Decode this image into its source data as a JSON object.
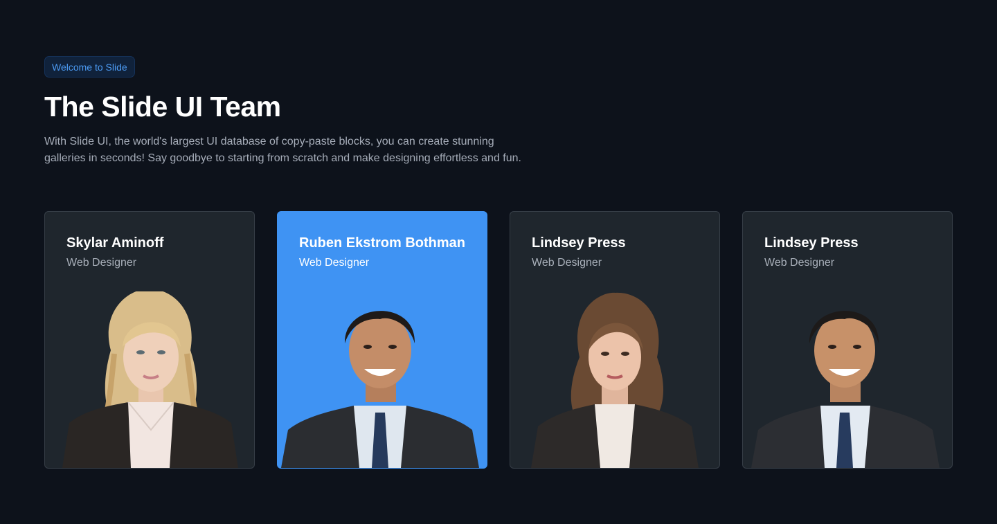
{
  "header": {
    "badge": "Welcome to Slide",
    "title": "The Slide UI Team",
    "description_line1": "With Slide UI, the world's largest UI database of copy-paste blocks, you can create stunning",
    "description_line2": "galleries in seconds! Say goodbye to starting from scratch and make designing effortless and fun."
  },
  "team": [
    {
      "name": "Skylar Aminoff",
      "role": "Web Designer",
      "portrait": "woman-blonde-portrait",
      "active": false
    },
    {
      "name": "Ruben Ekstrom Bothman",
      "role": "Web Designer",
      "portrait": "man-smiling-portrait",
      "active": true
    },
    {
      "name": "Lindsey Press",
      "role": "Web Designer",
      "portrait": "woman-brunette-portrait",
      "active": false
    },
    {
      "name": "Lindsey Press",
      "role": "Web Designer",
      "portrait": "man-smiling-portrait",
      "active": false
    }
  ],
  "colors": {
    "background": "#0d121b",
    "card": "#1f262d",
    "card_active": "#3f93f3",
    "badge_text": "#4d9cf5"
  }
}
